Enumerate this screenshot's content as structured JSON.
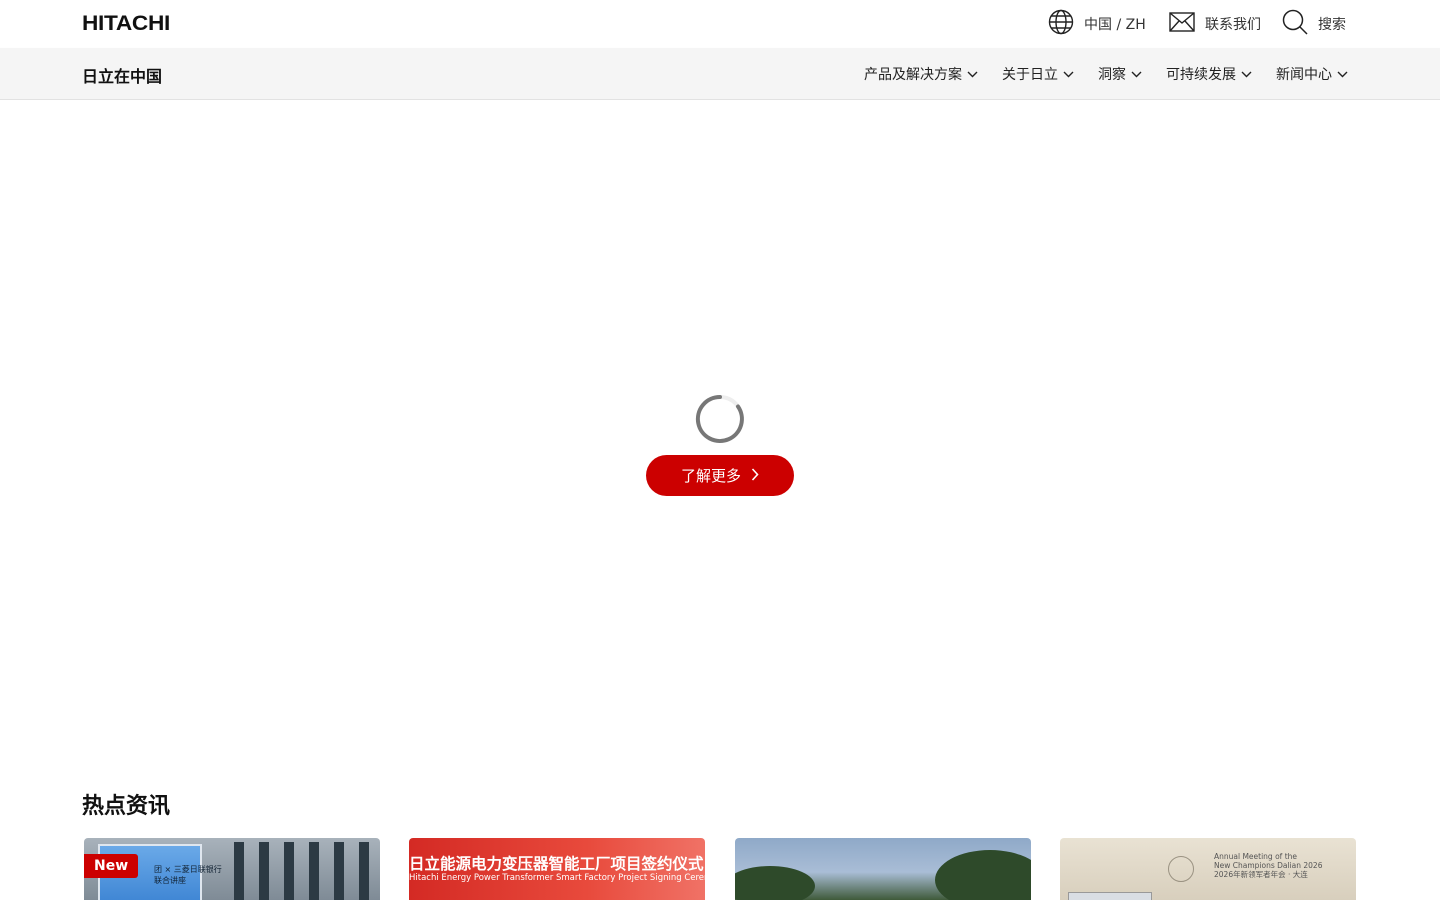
{
  "header": {
    "logo": "HITACHI",
    "lang_label": "中国 / ZH",
    "contact_label": "联系我们",
    "search_label": "搜索"
  },
  "subnav": {
    "site_title": "日立在中国",
    "items": [
      {
        "label": "产品及解决方案"
      },
      {
        "label": "关于日立"
      },
      {
        "label": "洞察"
      },
      {
        "label": "可持续发展"
      },
      {
        "label": "新闻中心"
      }
    ]
  },
  "hero": {
    "cta_label": "了解更多"
  },
  "news": {
    "section_title": "热点资讯",
    "cards": [
      {
        "badge": "New",
        "image_text": "团 × 三菱日联银行\n联合讲座"
      },
      {
        "image_text": "日立能源电力变压器智能工厂项目签约仪式",
        "image_subtext": "Hitachi Energy Power Transformer Smart Factory Project Signing Ceremony"
      },
      {},
      {
        "image_text": "Annual Meeting of the\nNew Champions Dalian 2026\n2026年新领军者年会 · 大连"
      }
    ]
  },
  "colors": {
    "brand_red": "#cc0000",
    "subnav_bg": "#f5f5f5"
  }
}
